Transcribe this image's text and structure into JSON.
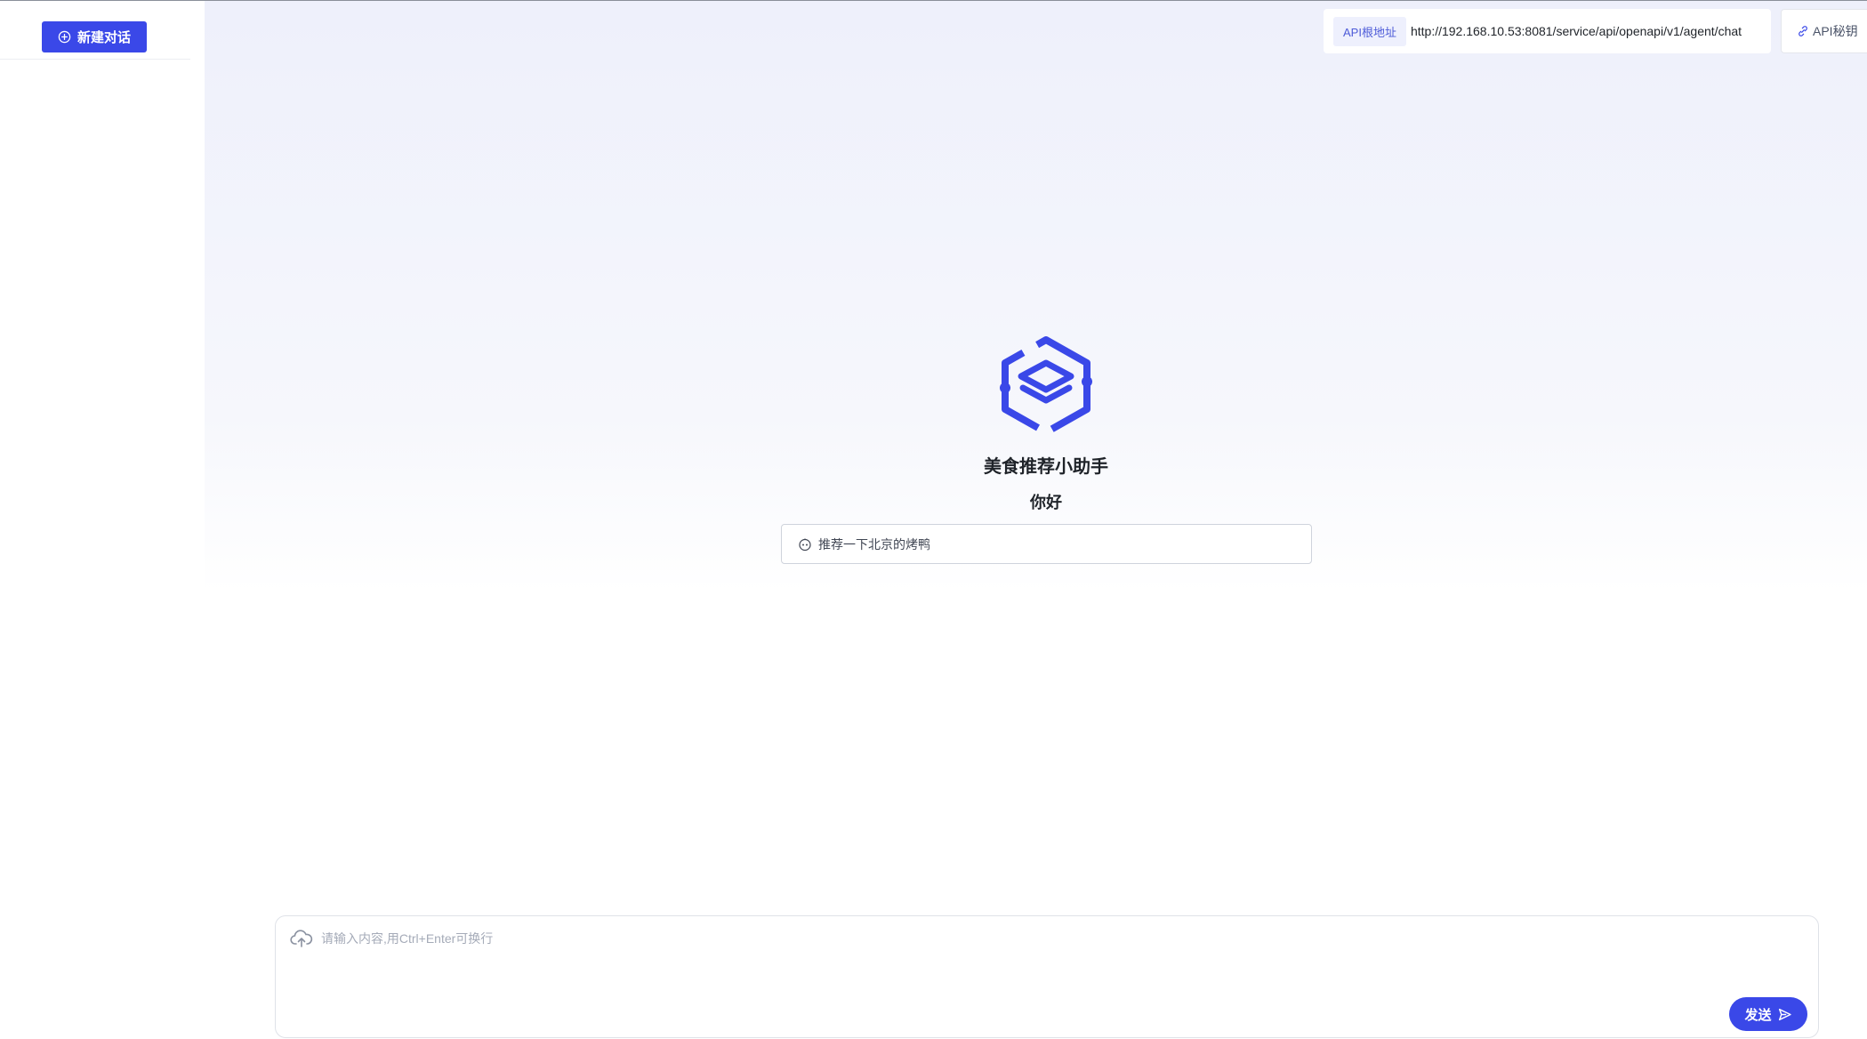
{
  "sidebar": {
    "new_chat_label": "新建对话"
  },
  "header": {
    "api_address_tag": "API根地址",
    "api_address_url": "http://192.168.10.53:8081/service/api/openapi/v1/agent/chat",
    "api_key_label": "API秘钥"
  },
  "welcome": {
    "app_name": "美食推荐小助手",
    "greeting": "你好",
    "suggestion": "推荐一下北京的烤鸭"
  },
  "composer": {
    "placeholder": "请输入内容,用Ctrl+Enter可换行",
    "send_label": "发送"
  },
  "colors": {
    "accent": "#3a48e8",
    "tag_bg": "#eef0fd"
  },
  "icons": [
    "plus-circle-icon",
    "link-icon",
    "hexagon-logo-icon",
    "robot-icon",
    "cloud-upload-icon",
    "send-icon"
  ]
}
